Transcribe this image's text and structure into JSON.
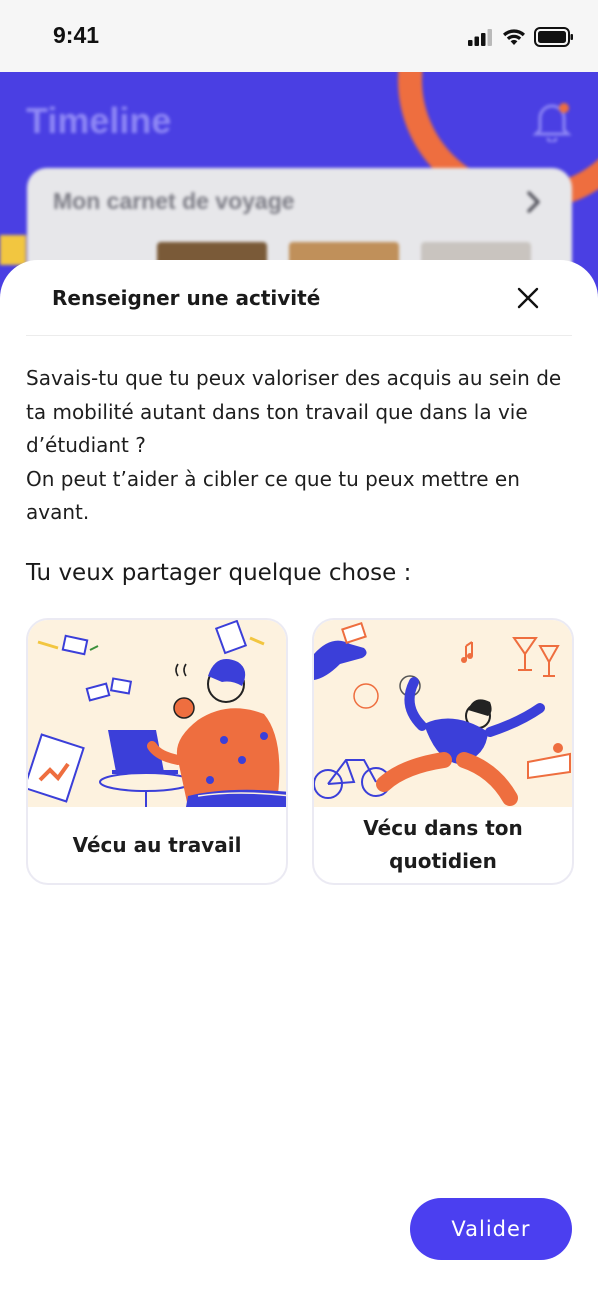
{
  "status_bar": {
    "time": "9:41",
    "icons": [
      "cellular-signal-icon",
      "wifi-icon",
      "battery-icon"
    ]
  },
  "background_app": {
    "title": "Timeline",
    "card_title": "Mon carnet de voyage",
    "icons": [
      "bell-icon",
      "chevron-right-icon"
    ]
  },
  "sheet": {
    "title": "Renseigner une activité",
    "close_icon": "close-icon",
    "intro_line1": "Savais-tu que tu peux valoriser des acquis au sein de ta mobilité autant dans ton travail que dans la vie d’étudiant ?",
    "intro_line2": "On peut t’aider à cibler ce que tu peux mettre en avant.",
    "question": "Tu veux partager quelque chose :",
    "options": [
      {
        "label": "Vécu au travail"
      },
      {
        "label": "Vécu dans ton quotidien"
      }
    ],
    "submit_label": "Valider"
  },
  "colors": {
    "primary": "#4b3ff0",
    "accent_orange": "#ee6e3f",
    "illustration_bg": "#fdf2df",
    "accent_yellow": "#f2c640"
  }
}
